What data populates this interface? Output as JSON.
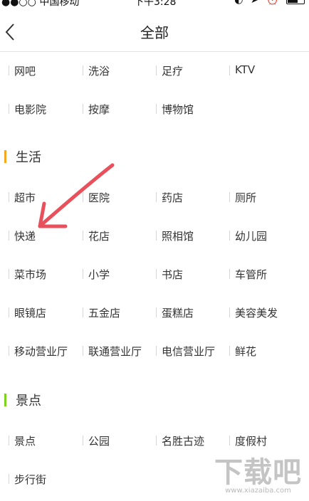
{
  "status_bar": {
    "carrier": "●●○○ 中国移动",
    "time": "下午3:28",
    "indicators": "◐ ➤ ⏰"
  },
  "nav": {
    "title": "全部",
    "back_icon": "chevron-left-icon"
  },
  "top_rows": [
    [
      "网吧",
      "洗浴",
      "足疗",
      "KTV"
    ],
    [
      "电影院",
      "按摩",
      "博物馆"
    ]
  ],
  "sections": [
    {
      "title": "生活",
      "accent": "#f5a623",
      "rows": [
        [
          "超市",
          "医院",
          "药店",
          "厕所"
        ],
        [
          "快递",
          "花店",
          "照相馆",
          "幼儿园"
        ],
        [
          "菜市场",
          "小学",
          "书店",
          "车管所"
        ],
        [
          "眼镜店",
          "五金店",
          "蛋糕店",
          "美容美发"
        ],
        [
          "移动营业厅",
          "联通营业厅",
          "电信营业厅",
          "鲜花"
        ]
      ]
    },
    {
      "title": "景点",
      "accent": "#7ed321",
      "rows": [
        [
          "景点",
          "公园",
          "名胜古迹",
          "度假村"
        ],
        [
          "步行街"
        ]
      ]
    }
  ],
  "annotation": {
    "color": "#e8505b"
  },
  "watermark": {
    "logo": "下载吧",
    "url": "www.xiazaiba.com"
  }
}
